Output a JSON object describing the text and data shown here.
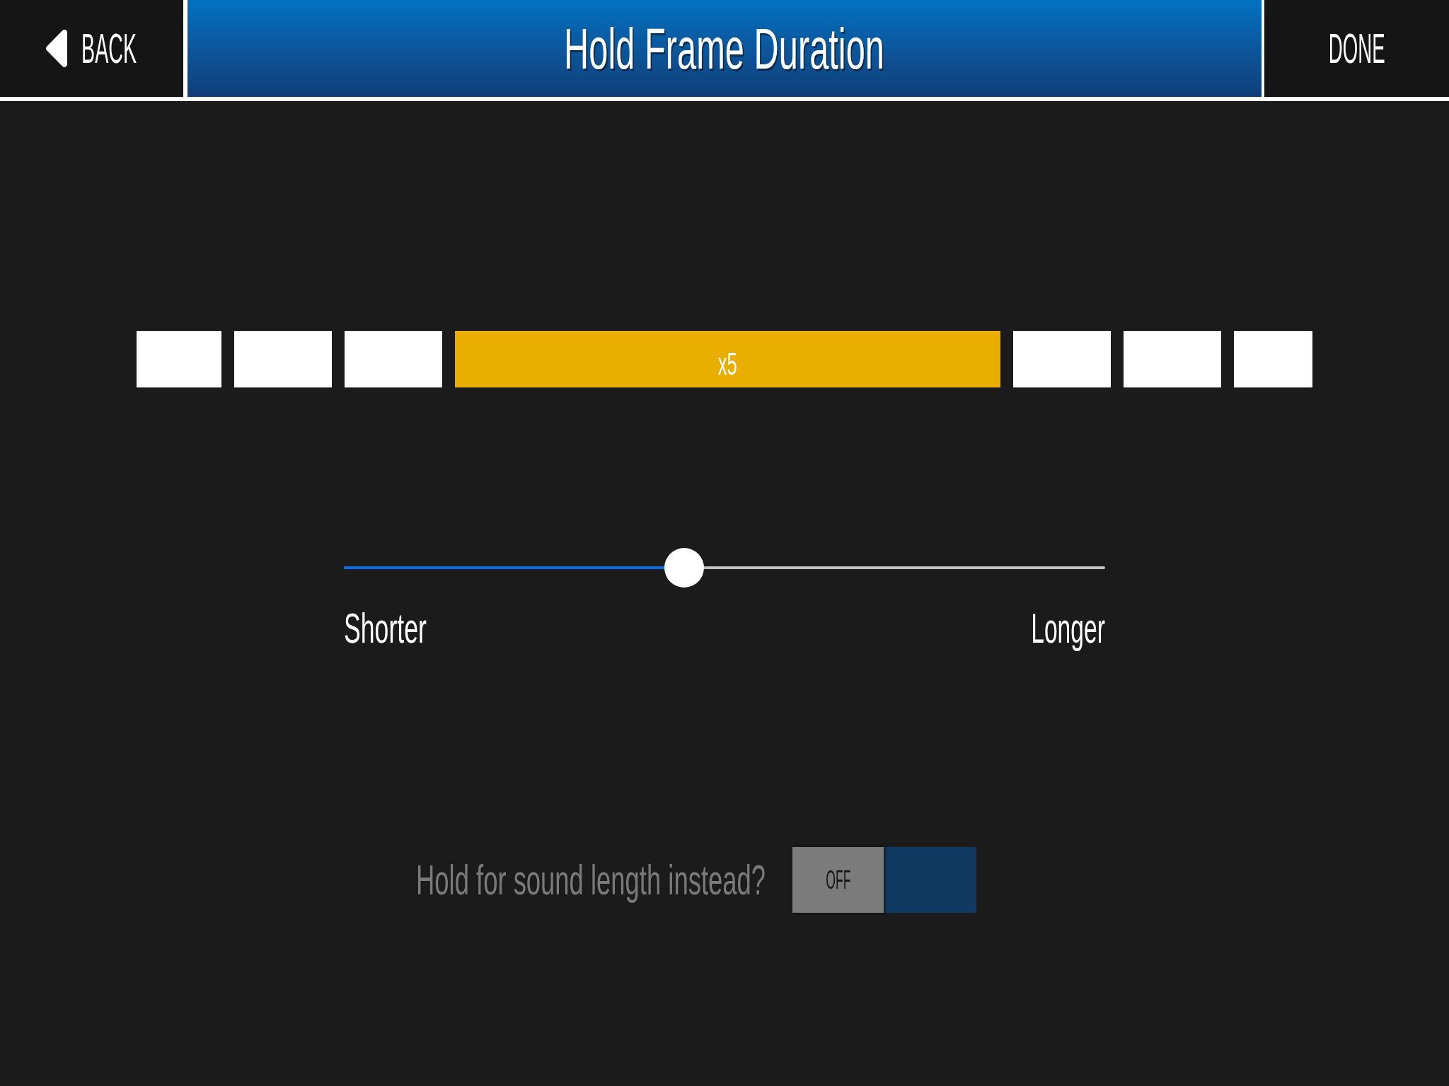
{
  "header": {
    "back_label": "BACK",
    "title": "Hold Frame Duration",
    "done_label": "DONE"
  },
  "frames": [
    {
      "selected": false
    },
    {
      "selected": false
    },
    {
      "selected": false
    },
    {
      "selected": true,
      "label": "x5"
    },
    {
      "selected": false
    },
    {
      "selected": false
    },
    {
      "selected": false
    }
  ],
  "slider": {
    "level": 0.447,
    "min_label": "Shorter",
    "max_label": "Longer"
  },
  "sound_toggle": {
    "label": "Hold for sound length instead?",
    "on": false,
    "off_label": "OFF"
  }
}
